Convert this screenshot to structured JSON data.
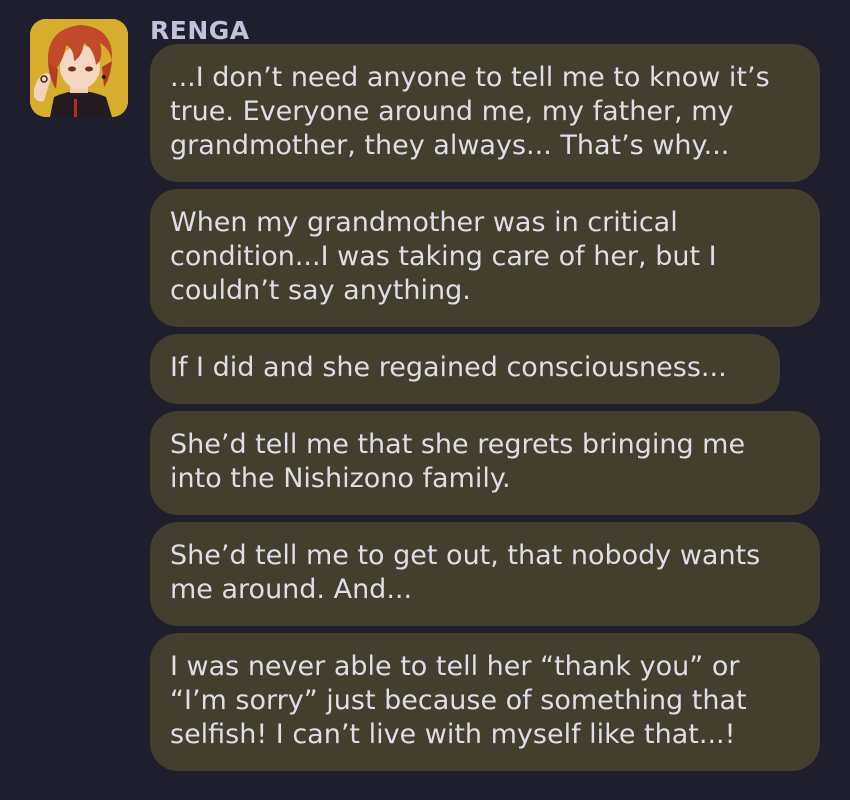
{
  "chat": {
    "sender": "RENGA",
    "avatar_icon": "character-portrait",
    "messages": [
      {
        "text": "...I don’t need anyone to tell me to know it’s true. Everyone around me, my father, my grandmother, they always... That’s why..."
      },
      {
        "text": "When my grandmother was in critical condition...I was taking care of her, but I couldn’t say anything."
      },
      {
        "text": "If I did and she regained consciousness..."
      },
      {
        "text": "She’d tell me that she regrets bringing me into the Nishizono family."
      },
      {
        "text": "She’d tell me to get out, that nobody wants me around. And..."
      },
      {
        "text": "I was never able to tell her “thank you” or “I’m sorry” just because of something that selfish! I can’t live with myself like that...!"
      }
    ]
  },
  "colors": {
    "background": "#1f1e2d",
    "bubble": "#433e2e",
    "text": "#dfdde8",
    "sender": "#c2c2dc"
  }
}
